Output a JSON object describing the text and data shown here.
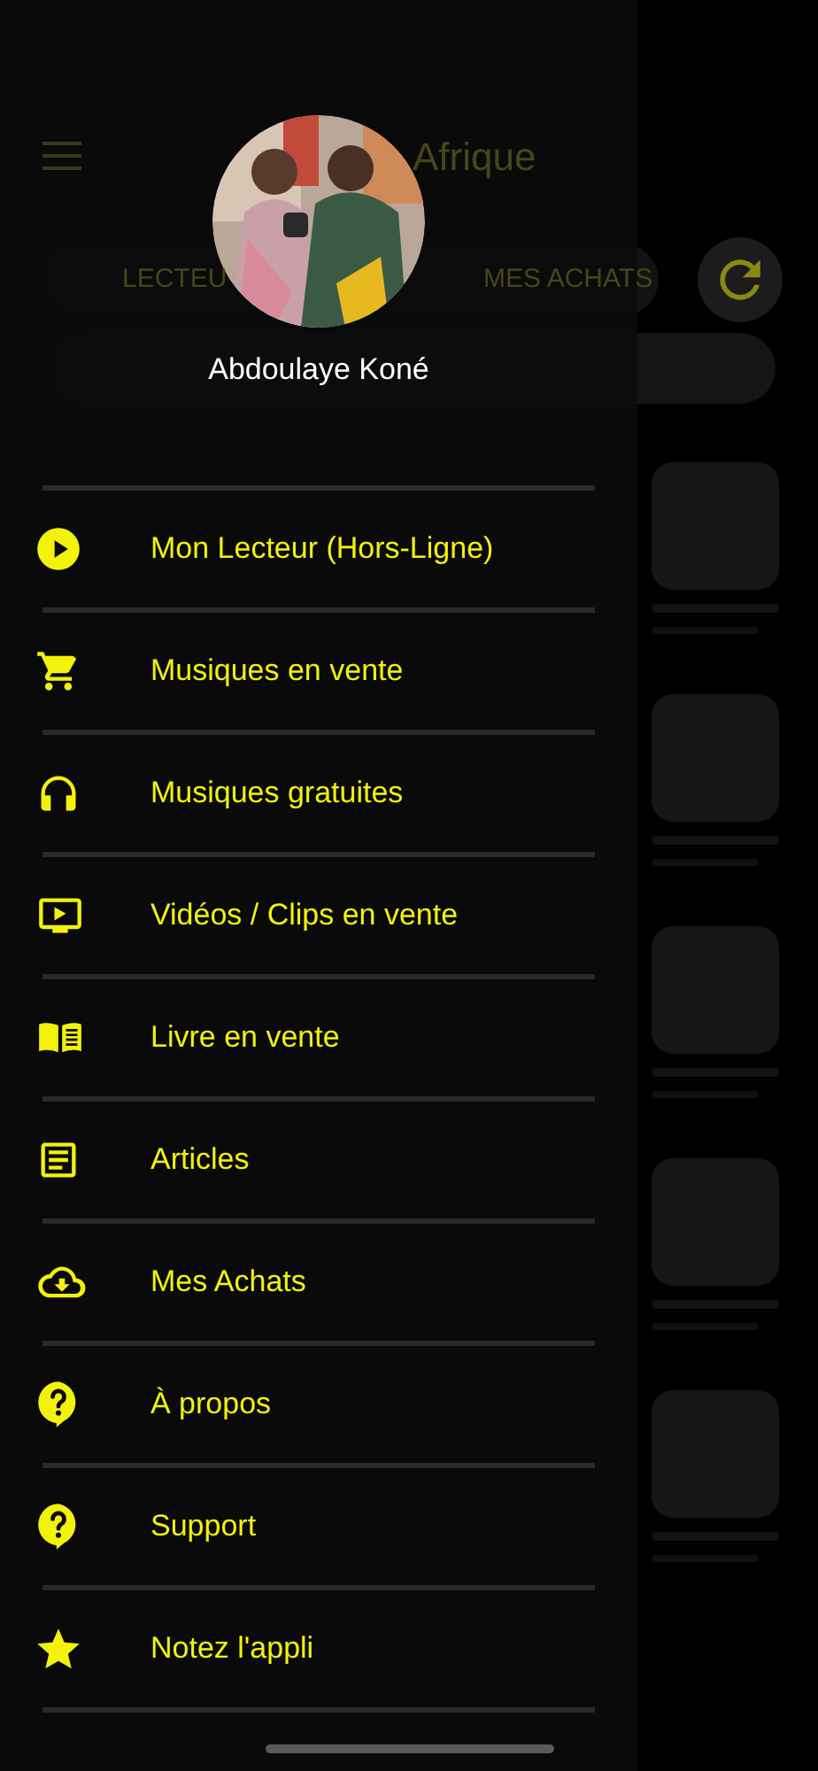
{
  "background_app": {
    "title": "Afrique",
    "tabs": [
      "LECTEU",
      "MES ACHATS"
    ]
  },
  "drawer": {
    "profile": {
      "name": "Abdoulaye Koné"
    },
    "items": [
      {
        "label": "Mon Lecteur (Hors-Ligne)"
      },
      {
        "label": "Musiques en vente"
      },
      {
        "label": "Musiques gratuites"
      },
      {
        "label": "Vidéos / Clips en vente"
      },
      {
        "label": "Livre en vente"
      },
      {
        "label": "Articles"
      },
      {
        "label": "Mes Achats"
      },
      {
        "label": "À propos"
      },
      {
        "label": "Support"
      },
      {
        "label": "Notez l'appli"
      }
    ]
  }
}
